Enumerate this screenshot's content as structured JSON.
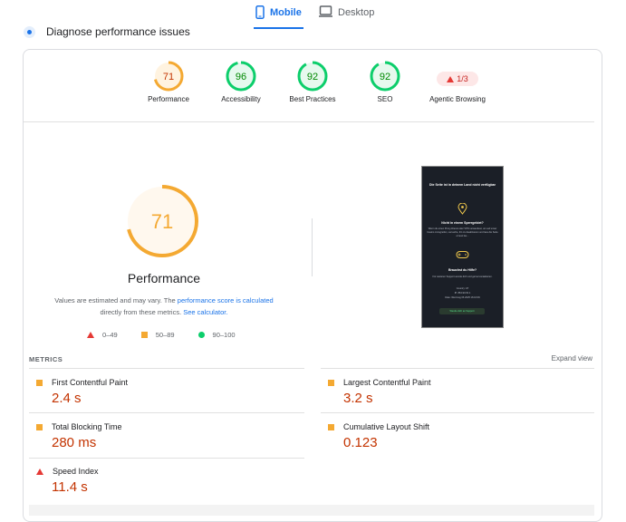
{
  "tabs": [
    {
      "label": "Mobile",
      "active": true,
      "icon": "mobile-icon"
    },
    {
      "label": "Desktop",
      "active": false,
      "icon": "desktop-icon"
    }
  ],
  "header": {
    "title": "Diagnose performance issues"
  },
  "gauges": [
    {
      "label": "Performance",
      "value": "71",
      "score": 71,
      "status": "average"
    },
    {
      "label": "Accessibility",
      "value": "96",
      "score": 96,
      "status": "pass"
    },
    {
      "label": "Best Practices",
      "value": "92",
      "score": 92,
      "status": "pass"
    },
    {
      "label": "SEO",
      "value": "92",
      "score": 92,
      "status": "pass"
    }
  ],
  "agentic": {
    "label": "Agentic Browsing",
    "value": "1/3"
  },
  "main": {
    "score": "71",
    "score_value": 71,
    "title": "Performance",
    "note_a": "Values are estimated and may vary. The",
    "note_link1": "performance score is calculated",
    "note_b": "directly from these metrics.",
    "note_link2": "See calculator."
  },
  "legend": [
    {
      "range": "0–49",
      "shape": "triangle"
    },
    {
      "range": "50–89",
      "shape": "square"
    },
    {
      "range": "90–100",
      "shape": "circle"
    }
  ],
  "screenshot": {
    "title": "Die Seite ist in deinem Land nicht verfügbar",
    "q1": "Nicht in einem Sperrgebiet?",
    "t1": "Wenn du einen Proxy-Dienst oder VPN verwendest, um auf unser Casino zuzugreifen, versuche, ihn zu deaktivieren und lass die Seite erneut lau...",
    "q2": "Brauchst du Hilfe?",
    "t2": "Für weiteren Support wende dich und gerne kontaktieren.",
    "info1": "Country: AT",
    "info2": "IP: 88.190.63.1",
    "info3": "Date: Wed Aug 06 2025 16:16:09",
    "button": "Wende dich an Support"
  },
  "metrics": {
    "heading": "METRICS",
    "expand": "Expand view",
    "items": [
      {
        "name": "First Contentful Paint",
        "value": "2.4 s",
        "status": "average"
      },
      {
        "name": "Largest Contentful Paint",
        "value": "3.2 s",
        "status": "average"
      },
      {
        "name": "Total Blocking Time",
        "value": "280 ms",
        "status": "average"
      },
      {
        "name": "Cumulative Layout Shift",
        "value": "0.123",
        "status": "average"
      },
      {
        "name": "Speed Index",
        "value": "11.4 s",
        "status": "fail"
      }
    ]
  },
  "colors": {
    "pass": "#0cce6b",
    "average": "#ffa400",
    "fail": "#e53935",
    "accent": "#1a73e8",
    "metric_value": "#c33300"
  }
}
